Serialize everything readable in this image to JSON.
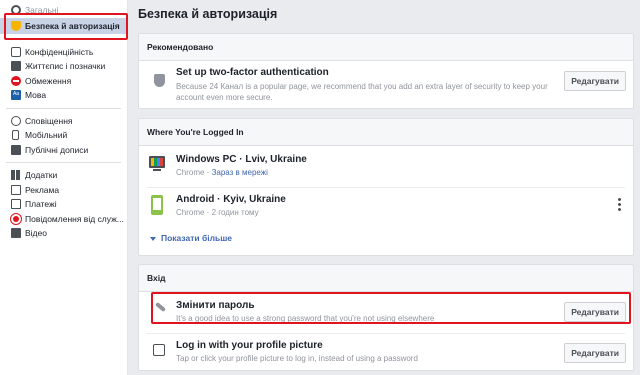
{
  "sidebar": {
    "items": [
      {
        "label": "Загальні",
        "icon": "gear-icon"
      },
      {
        "label": "Безпека й авторизація",
        "icon": "shield-icon",
        "active": true
      },
      {
        "label": "Конфіденційність",
        "icon": "lock-icon"
      },
      {
        "label": "Життєпис і позначки",
        "icon": "tag-icon"
      },
      {
        "label": "Обмеження",
        "icon": "block-icon"
      },
      {
        "label": "Мова",
        "icon": "language-icon",
        "icon_text": "Aa"
      },
      {
        "label": "Сповіщення",
        "icon": "globe-icon"
      },
      {
        "label": "Мобільний",
        "icon": "phone-icon"
      },
      {
        "label": "Публічні дописи",
        "icon": "rss-icon"
      },
      {
        "label": "Додатки",
        "icon": "apps-icon"
      },
      {
        "label": "Реклама",
        "icon": "ad-icon"
      },
      {
        "label": "Платежі",
        "icon": "payment-icon"
      },
      {
        "label": "Повідомлення від служ...",
        "icon": "help-icon"
      },
      {
        "label": "Відео",
        "icon": "video-icon"
      }
    ]
  },
  "main": {
    "title": "Безпека й авторизація",
    "recommended": {
      "header": "Рекомендовано",
      "title": "Set up two-factor authentication",
      "description": "Because 24 Канал is a popular page, we recommend that you add an extra layer of security to keep your account even more secure.",
      "button": "Редагувати"
    },
    "logged_in": {
      "header": "Where You're Logged In",
      "sessions": [
        {
          "device": "Windows PC · Lviv, Ukraine",
          "browser": "Chrome",
          "time": "Зараз в мережі",
          "icon": "monitor-icon"
        },
        {
          "device": "Android · Kyiv, Ukraine",
          "browser": "Chrome",
          "time": "2 годин тому",
          "icon": "android-phone-icon"
        }
      ],
      "more": "Показати більше"
    },
    "login": {
      "header": "Вхід",
      "items": [
        {
          "title": "Змінити пароль",
          "description": "It's a good idea to use a strong password that you're not using elsewhere",
          "button": "Редагувати"
        },
        {
          "title": "Log in with your profile picture",
          "description": "Tap or click your profile picture to log in, instead of using a password",
          "button": "Редагувати"
        }
      ]
    }
  },
  "colors": {
    "accent": "#4267b2",
    "highlight": "#e0141e",
    "active_bg": "#c9d3e6"
  }
}
